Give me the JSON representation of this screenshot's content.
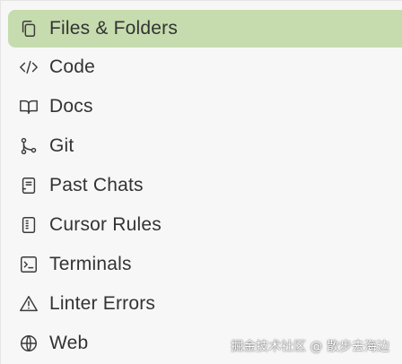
{
  "menu": {
    "selected_index": 0,
    "accent_color": "#c6dcae",
    "items": [
      {
        "label": "Files & Folders",
        "icon": "copy-files-icon"
      },
      {
        "label": "Code",
        "icon": "code-brackets-icon"
      },
      {
        "label": "Docs",
        "icon": "open-book-icon"
      },
      {
        "label": "Git",
        "icon": "git-branch-icon"
      },
      {
        "label": "Past Chats",
        "icon": "chat-notebook-icon"
      },
      {
        "label": "Cursor Rules",
        "icon": "rules-document-icon"
      },
      {
        "label": "Terminals",
        "icon": "terminal-icon"
      },
      {
        "label": "Linter Errors",
        "icon": "warning-triangle-icon"
      },
      {
        "label": "Web",
        "icon": "globe-icon"
      }
    ]
  },
  "watermark": {
    "text": "掘金技术社区 @ 散步去海边"
  }
}
